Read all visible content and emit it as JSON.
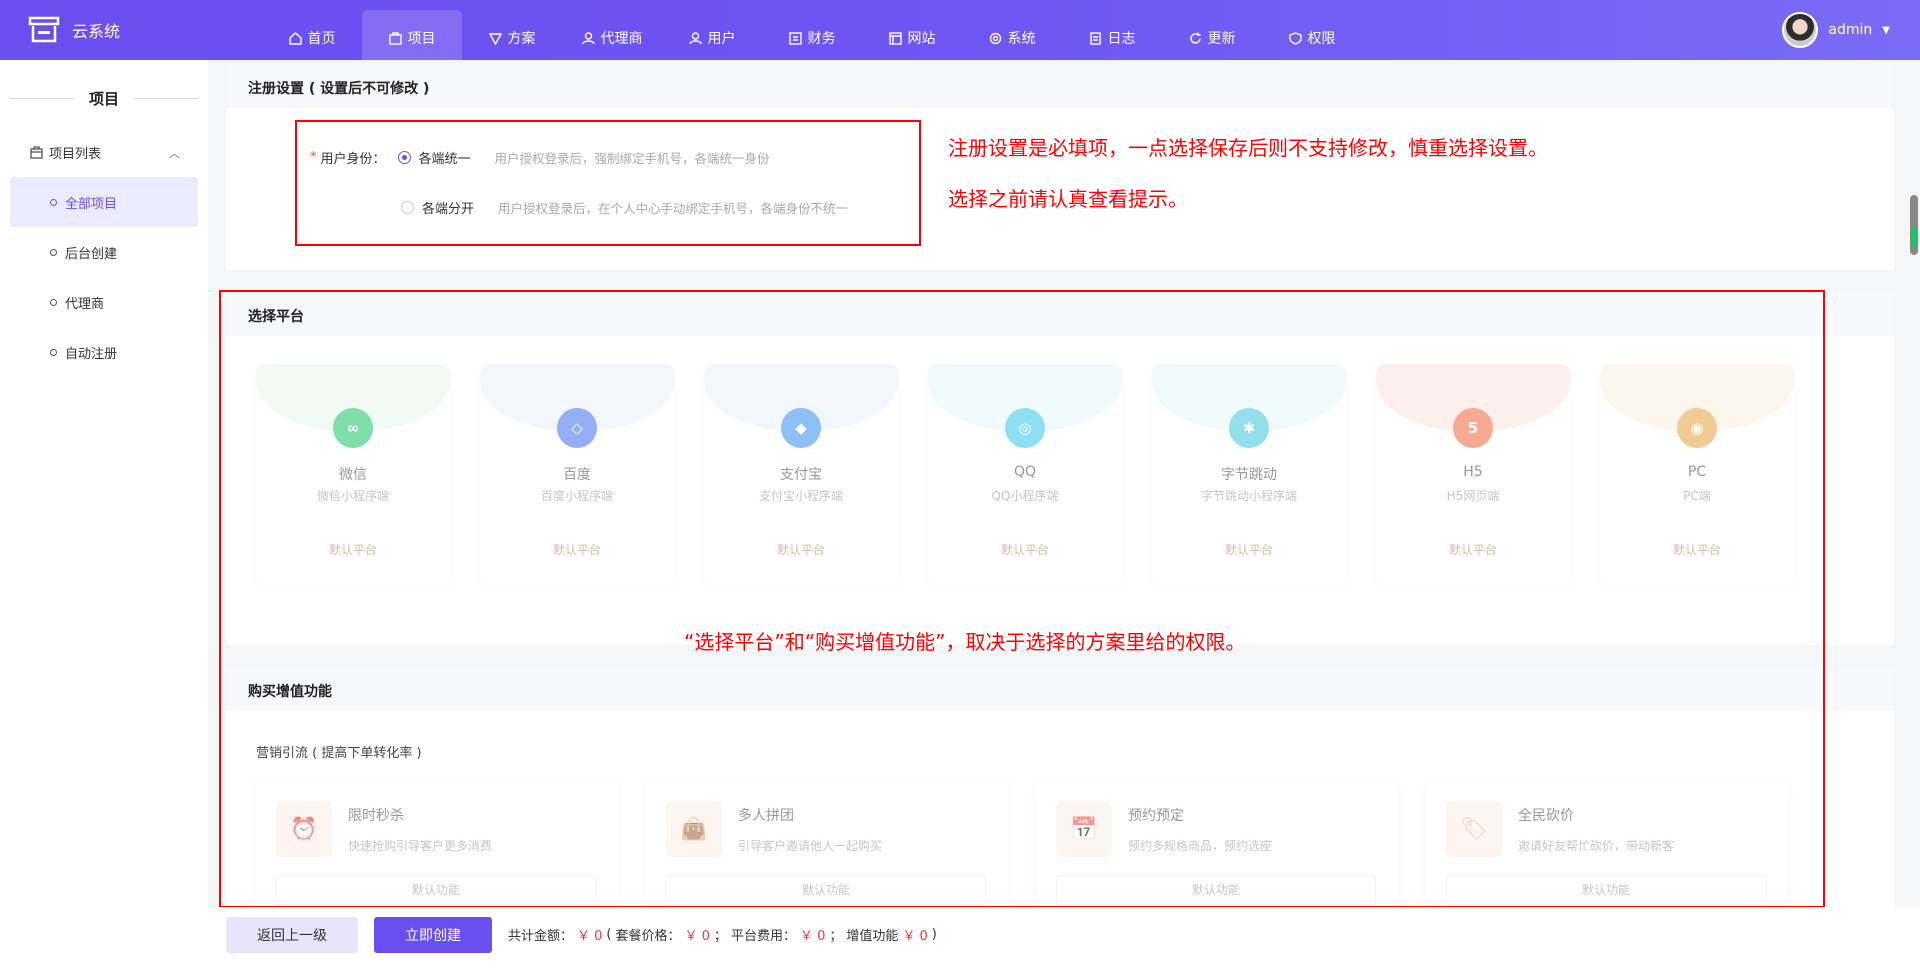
{
  "app": {
    "name": "云系统",
    "user": "admin"
  },
  "nav": [
    {
      "label": "首页",
      "icon": "home-icon",
      "active": false
    },
    {
      "label": "项目",
      "icon": "project-icon",
      "active": true
    },
    {
      "label": "方案",
      "icon": "plan-icon",
      "active": false
    },
    {
      "label": "代理商",
      "icon": "agent-icon",
      "active": false
    },
    {
      "label": "用户",
      "icon": "user-icon",
      "active": false
    },
    {
      "label": "财务",
      "icon": "finance-icon",
      "active": false
    },
    {
      "label": "网站",
      "icon": "website-icon",
      "active": false
    },
    {
      "label": "系统",
      "icon": "system-icon",
      "active": false
    },
    {
      "label": "日志",
      "icon": "log-icon",
      "active": false
    },
    {
      "label": "更新",
      "icon": "refresh-icon",
      "active": false
    },
    {
      "label": "权限",
      "icon": "permission-icon",
      "active": false
    }
  ],
  "sidebar": {
    "title": "项目",
    "group": "项目列表",
    "items": [
      {
        "label": "全部项目",
        "active": true
      },
      {
        "label": "后台创建",
        "active": false
      },
      {
        "label": "代理商",
        "active": false
      },
      {
        "label": "自动注册",
        "active": false
      }
    ]
  },
  "register": {
    "title": "注册设置 ( 设置后不可修改 )",
    "field_label": "用户身份：",
    "required_mark": "*",
    "options": [
      {
        "label": "各端统一",
        "hint": "用户授权登录后，强制绑定手机号，各端统一身份",
        "checked": true
      },
      {
        "label": "各端分开",
        "hint": "用户授权登录后，在个人中心手动绑定手机号，各端身份不统一",
        "checked": false
      }
    ]
  },
  "platforms": {
    "title": "选择平台",
    "items": [
      {
        "name": "微信",
        "sub": "微信小程序端",
        "tag": "默认平台",
        "color": "#19c463",
        "tint": "#e7f7ee",
        "glyph": "∞"
      },
      {
        "name": "百度",
        "sub": "百度小程序端",
        "tag": "默认平台",
        "color": "#3f6df0",
        "tint": "#eaf0fc",
        "glyph": "◇"
      },
      {
        "name": "支付宝",
        "sub": "支付宝小程序端",
        "tag": "默认平台",
        "color": "#2f8ef0",
        "tint": "#eaf0fc",
        "glyph": "◆"
      },
      {
        "name": "QQ",
        "sub": "QQ小程序端",
        "tag": "默认平台",
        "color": "#35c5e8",
        "tint": "#e6f7fc",
        "glyph": "◎"
      },
      {
        "name": "字节跳动",
        "sub": "字节跳动小程序端",
        "tag": "默认平台",
        "color": "#3cc6e0",
        "tint": "#e6f8fa",
        "glyph": "✱"
      },
      {
        "name": "H5",
        "sub": "H5网页端",
        "tag": "默认平台",
        "color": "#f2663a",
        "tint": "#fde4de",
        "glyph": "5"
      },
      {
        "name": "PC",
        "sub": "PC端",
        "tag": "默认平台",
        "color": "#e6a23c",
        "tint": "#fdf0e1",
        "glyph": "◉"
      }
    ]
  },
  "features": {
    "title": "购买增值功能",
    "group": "营销引流 ( 提高下单转化率 )",
    "items": [
      {
        "name": "限时秒杀",
        "desc": "快速抢购引导客户更多消费",
        "tag": "默认功能",
        "glyph": "⏰"
      },
      {
        "name": "多人拼团",
        "desc": "引导客户邀请他人一起购买",
        "tag": "默认功能",
        "glyph": "👜"
      },
      {
        "name": "预约预定",
        "desc": "预约多规格商品，预约选座",
        "tag": "默认功能",
        "glyph": "📅"
      },
      {
        "name": "全民砍价",
        "desc": "邀请好友帮忙砍价，带动新客",
        "tag": "默认功能",
        "glyph": "🏷"
      }
    ]
  },
  "annotations": {
    "a1": "注册设置是必填项，一点选择保存后则不支持修改，慎重选择设置。",
    "a2": "选择之前请认真查看提示。",
    "a3": "“选择平台”和“购买增值功能”，取决于选择的方案里给的权限。"
  },
  "footer": {
    "back": "返回上一级",
    "create": "立即创建",
    "total_label": "共计金额：",
    "total": "￥ 0",
    "open": "(",
    "pkg_label": "套餐价格：",
    "pkg": "￥ 0",
    "sep1": "；",
    "platform_label": "平台费用：",
    "platform": "￥ 0",
    "sep2": "；",
    "feature_label": "增值功能",
    "feature": "￥ 0",
    "close": ")"
  }
}
